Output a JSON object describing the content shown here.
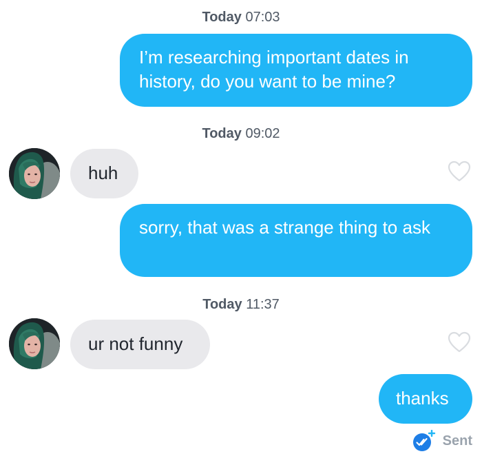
{
  "conversation": {
    "stamps": [
      {
        "day": "Today",
        "time": "07:03"
      },
      {
        "day": "Today",
        "time": "09:02"
      },
      {
        "day": "Today",
        "time": "11:37"
      }
    ],
    "messages": [
      {
        "direction": "outgoing",
        "text": "I’m researching important dates in history, do you want to be mine?"
      },
      {
        "direction": "incoming",
        "text": "huh",
        "liked": false
      },
      {
        "direction": "outgoing",
        "text": "sorry, that was a strange thing to ask"
      },
      {
        "direction": "incoming",
        "text": "ur not funny",
        "liked": false
      },
      {
        "direction": "outgoing",
        "text": "thanks"
      }
    ],
    "delivery_status": {
      "label": "Sent",
      "icon": "double-check-icon"
    }
  },
  "colors": {
    "outgoing_bubble": "#21b6f6",
    "incoming_bubble": "#e9e9ec",
    "status_badge": "#1e7ee6",
    "plus_badge": "#21b6f6"
  }
}
